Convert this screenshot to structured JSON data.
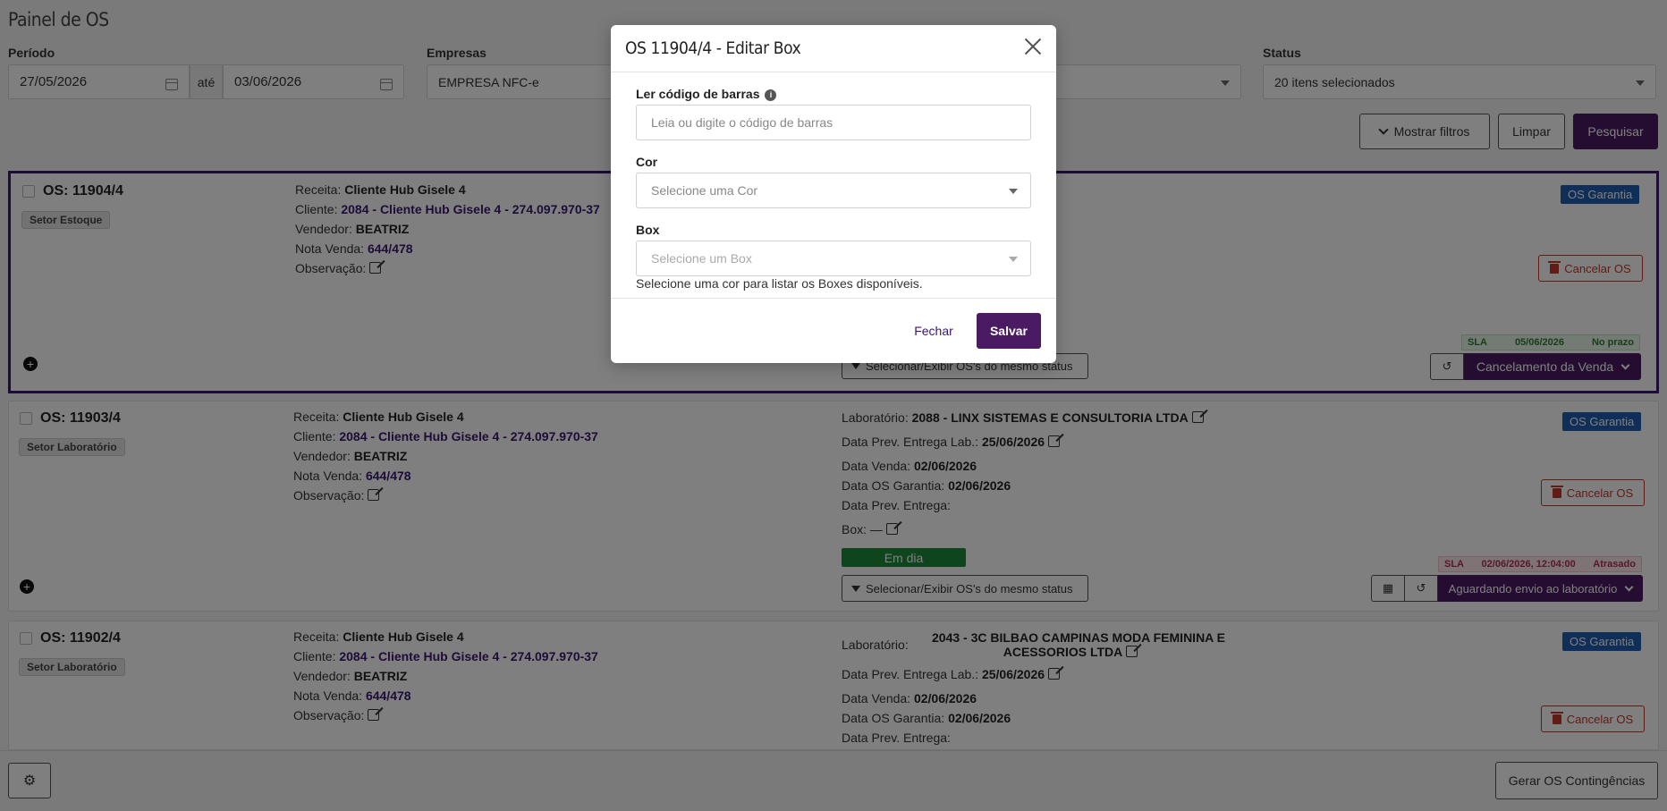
{
  "page": {
    "title": "Painel de OS"
  },
  "filters": {
    "periodo_label": "Período",
    "date_from": "27/05/2026",
    "ate": "até",
    "date_to": "03/06/2026",
    "empresas_label": "Empresas",
    "empresa_value": "EMPRESA NFC-e",
    "status_label": "Status",
    "status_value": "20 itens selecionados",
    "mostrar_filtros": "Mostrar filtros",
    "limpar": "Limpar",
    "pesquisar": "Pesquisar"
  },
  "cards": [
    {
      "os": "OS: 11904/4",
      "setor": "Setor Estoque",
      "receita_label": "Receita:",
      "receita": "Cliente Hub Gisele 4",
      "cliente_label": "Cliente:",
      "cliente": "2084 - Cliente Hub Gisele 4 - 274.097.970-37",
      "vendedor_label": "Vendedor:",
      "vendedor": "BEATRIZ",
      "nota_label": "Nota Venda:",
      "nota": "644/478",
      "obs_label": "Observação:",
      "garantia": "OS Garantia",
      "cancelar": "Cancelar OS",
      "sla_label": "SLA",
      "sla_date": "05/06/2026",
      "sla_status": "No prazo",
      "selecionar": "Selecionar/Exibir OS's do mesmo status",
      "status_action": "Cancelamento da Venda"
    },
    {
      "os": "OS: 11903/4",
      "setor": "Setor Laboratório",
      "receita_label": "Receita:",
      "receita": "Cliente Hub Gisele 4",
      "cliente_label": "Cliente:",
      "cliente": "2084 - Cliente Hub Gisele 4 - 274.097.970-37",
      "vendedor_label": "Vendedor:",
      "vendedor": "BEATRIZ",
      "nota_label": "Nota Venda:",
      "nota": "644/478",
      "obs_label": "Observação:",
      "lab_label": "Laboratório:",
      "lab": "2088 - LINX SISTEMAS E CONSULTORIA LTDA",
      "prev_lab_label": "Data Prev. Entrega Lab.:",
      "prev_lab": "25/06/2026",
      "data_venda_label": "Data Venda:",
      "data_venda": "02/06/2026",
      "data_garantia_label": "Data OS Garantia:",
      "data_garantia": "02/06/2026",
      "prev_entrega_label": "Data Prev. Entrega:",
      "box_label": "Box:",
      "box": "—",
      "em_dia": "Em dia",
      "garantia": "OS Garantia",
      "cancelar": "Cancelar OS",
      "sla_label": "SLA",
      "sla_date": "02/06/2026, 12:04:00",
      "sla_status": "Atrasado",
      "selecionar": "Selecionar/Exibir OS's do mesmo status",
      "status_action": "Aguardando envio ao laboratório"
    },
    {
      "os": "OS: 11902/4",
      "setor": "Setor Laboratório",
      "receita_label": "Receita:",
      "receita": "Cliente Hub Gisele 4",
      "cliente_label": "Cliente:",
      "cliente": "2084 - Cliente Hub Gisele 4 - 274.097.970-37",
      "vendedor_label": "Vendedor:",
      "vendedor": "BEATRIZ",
      "nota_label": "Nota Venda:",
      "nota": "644/478",
      "obs_label": "Observação:",
      "lab_label": "Laboratório:",
      "lab_line1": "2043 - 3C BILBAO CAMPINAS MODA FEMININA E",
      "lab_line2": "ACESSORIOS LTDA",
      "prev_lab_label": "Data Prev. Entrega Lab.:",
      "prev_lab": "25/06/2026",
      "data_venda_label": "Data Venda:",
      "data_venda": "02/06/2026",
      "data_garantia_label": "Data OS Garantia:",
      "data_garantia": "02/06/2026",
      "prev_entrega_label": "Data Prev. Entrega:",
      "garantia": "OS Garantia",
      "cancelar": "Cancelar OS"
    }
  ],
  "footer": {
    "gerar": "Gerar OS Contingências"
  },
  "modal": {
    "title": "OS 11904/4 - Editar Box",
    "barcode_label": "Ler código de barras",
    "barcode_placeholder": "Leia ou digite o código de barras",
    "cor_label": "Cor",
    "cor_placeholder": "Selecione uma Cor",
    "box_label": "Box",
    "box_placeholder": "Selecione um Box",
    "hint": "Selecione uma cor para listar os Boxes disponíveis.",
    "fechar": "Fechar",
    "salvar": "Salvar"
  },
  "colors": {
    "primary": "#4a1b63",
    "garantia": "#1f5fb0",
    "danger": "#c0392b",
    "ok": "#1e8a3a"
  }
}
